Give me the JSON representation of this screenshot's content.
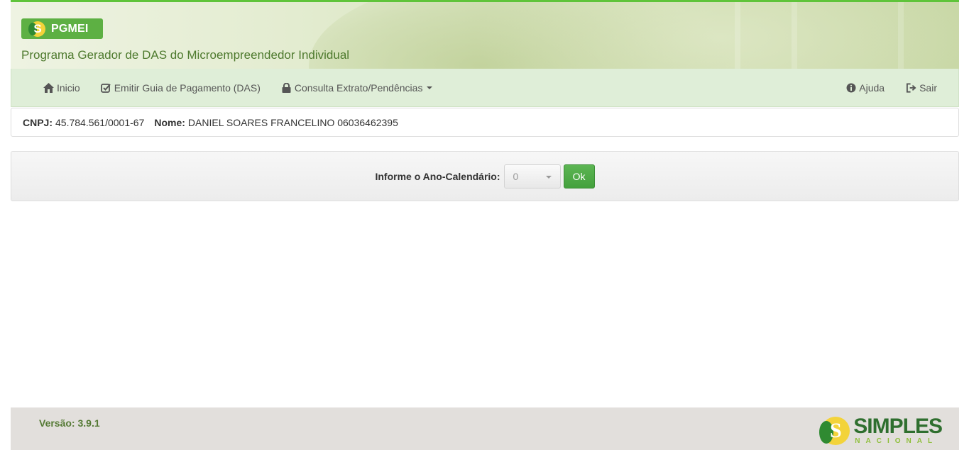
{
  "header": {
    "logo_text": "PGMEI",
    "logo_letter": "S",
    "app_title": "Programa Gerador de DAS do Microempreendedor Individual"
  },
  "nav": {
    "left": [
      {
        "label": "Inicio",
        "icon": "home-icon"
      },
      {
        "label": "Emitir Guia de Pagamento (DAS)",
        "icon": "check-square-icon"
      },
      {
        "label": "Consulta Extrato/Pendências",
        "icon": "lock-icon"
      }
    ],
    "right": [
      {
        "label": "Ajuda",
        "icon": "info-circle-icon"
      },
      {
        "label": "Sair",
        "icon": "sign-out-icon"
      }
    ]
  },
  "info": {
    "cnpj_label": "CNPJ:",
    "cnpj_value": "45.784.561/0001-67",
    "nome_label": "Nome:",
    "nome_value": "DANIEL SOARES FRANCELINO 06036462395"
  },
  "form": {
    "label": "Informe o Ano-Calendário:",
    "selected": "0",
    "ok_label": "Ok"
  },
  "footer": {
    "version": "Versão: 3.9.1",
    "brand_letter": "S",
    "brand_word1": "SIMPLES",
    "brand_word2": "NACIONAL"
  },
  "colors": {
    "accent_green": "#5db043",
    "nav_bg": "#dfeed8",
    "title_green": "#4e7a2e"
  }
}
